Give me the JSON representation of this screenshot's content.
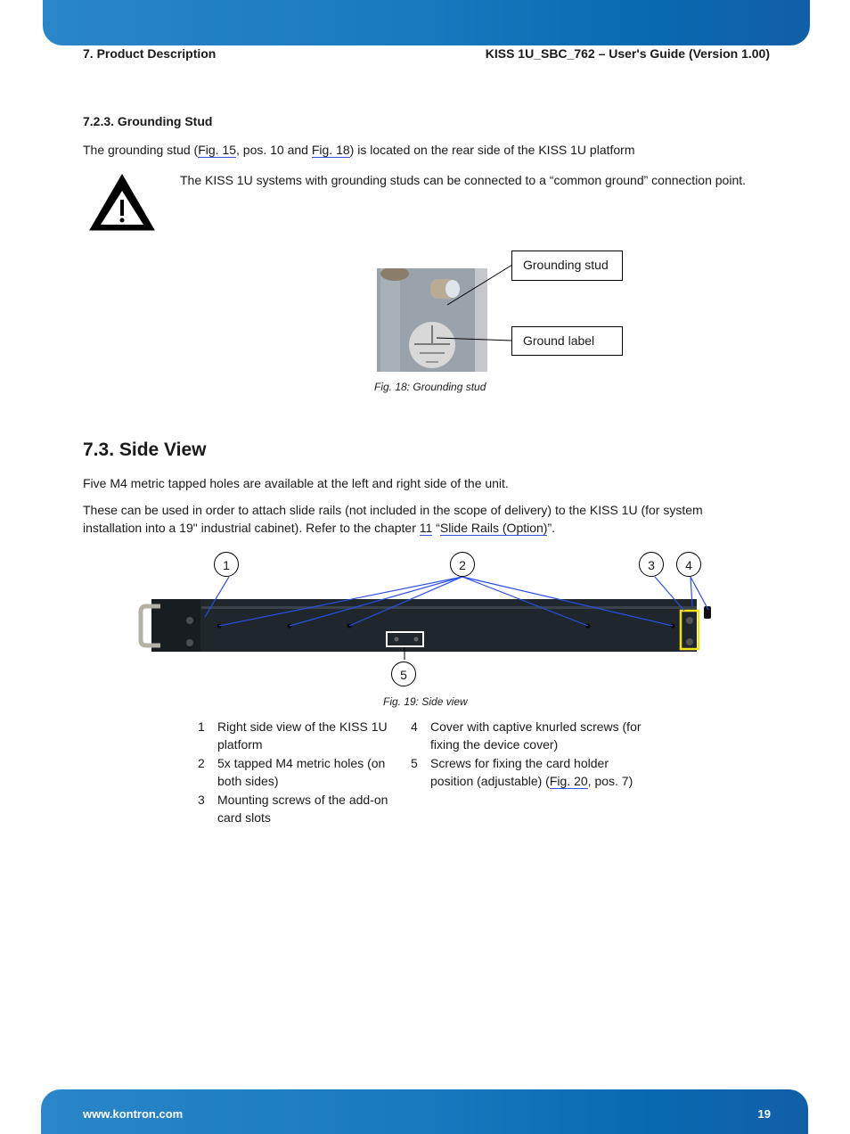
{
  "header": {
    "section": "7. Product Description",
    "doc_title": "KISS 1U_SBC_762 – User's Guide (Version 1.00)"
  },
  "grounding": {
    "heading": "7.2.3. Grounding Stud",
    "para_pre": "The grounding stud (",
    "link1": "Fig. 15",
    "para_mid": ", pos. 10 and ",
    "link2": "Fig. 18",
    "para_post": ") is located on the rear side of the KISS 1U platform",
    "warning_icon": "warning-triangle-icon",
    "warning_text": "The KISS 1U systems with grounding studs can be connected to a “common ground” connection point.",
    "callouts": [
      "Grounding stud",
      "Ground label"
    ],
    "caption": "Fig. 18:  Grounding stud"
  },
  "side_view": {
    "heading": "7.3. Side View",
    "para1": "Five M4 metric tapped holes are available at the left and right side of the unit.",
    "para2_line1": "These can be used in order to attach slide rails (not included in the scope of delivery) to the KISS 1U (for system",
    "para2_line2_pre": "installation into a 19\" industrial cabinet). Refer to the chapter ",
    "chapter_link": "11",
    "quote_open": " “",
    "chapter_title_link": "Slide Rails (Option)",
    "quote_close": "”.",
    "markers": [
      "1",
      "2",
      "3",
      "4",
      "5"
    ],
    "caption": "Fig. 19: Side view",
    "legend": [
      {
        "num": "1",
        "text": "Right side view of the KISS 1U platform"
      },
      {
        "num": "2",
        "text": "5x tapped M4 metric holes (on both sides)"
      },
      {
        "num": "3",
        "text": "Mounting screws of the add-on card slots"
      },
      {
        "num": "4",
        "text": "Cover with captive knurled screws (for fixing the device cover)"
      },
      {
        "num": "5",
        "text_pre": "Screws for fixing the card holder position (adjustable) (",
        "link": "Fig. 20",
        "text_post": ", pos. 7)"
      }
    ]
  },
  "footer": {
    "url": "www.kontron.com",
    "page": "19"
  }
}
